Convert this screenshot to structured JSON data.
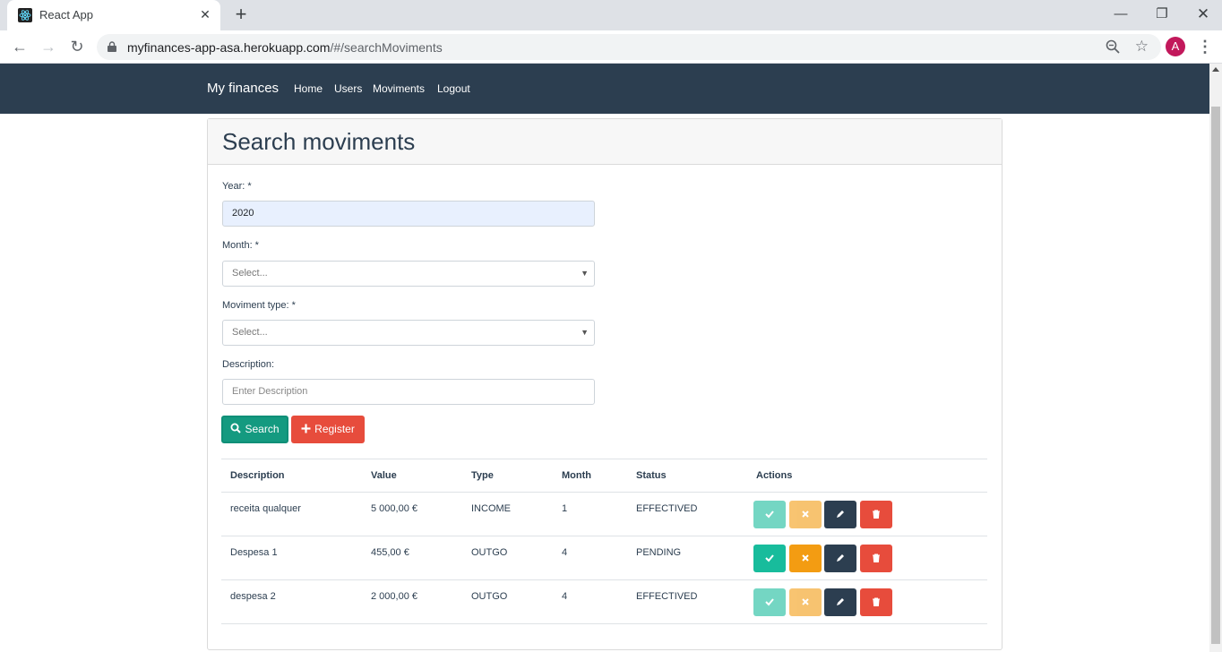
{
  "browser": {
    "tab_title": "React App",
    "url_host": "myfinances-app-asa.herokuapp.com",
    "url_path": "/#/searchMoviments",
    "avatar_letter": "A"
  },
  "navbar": {
    "brand": "My finances",
    "links": [
      "Home",
      "Users",
      "Moviments",
      "Logout"
    ]
  },
  "page": {
    "title": "Search moviments",
    "year_label": "Year: *",
    "year_value": "2020",
    "month_label": "Month: *",
    "month_placeholder": "Select...",
    "type_label": "Moviment type: *",
    "type_placeholder": "Select...",
    "description_label": "Description:",
    "description_placeholder": "Enter Description",
    "search_button": "Search",
    "register_button": "Register"
  },
  "table": {
    "headers": [
      "Description",
      "Value",
      "Type",
      "Month",
      "Status",
      "Actions"
    ],
    "rows": [
      {
        "description": "receita qualquer",
        "value": "5 000,00 €",
        "type": "INCOME",
        "month": "1",
        "status": "EFFECTIVED",
        "actions_enabled": false
      },
      {
        "description": "Despesa 1",
        "value": "455,00 €",
        "type": "OUTGO",
        "month": "4",
        "status": "PENDING",
        "actions_enabled": true
      },
      {
        "description": "despesa 2",
        "value": "2 000,00 €",
        "type": "OUTGO",
        "month": "4",
        "status": "EFFECTIVED",
        "actions_enabled": false
      }
    ]
  },
  "colors": {
    "navbar": "#2c3e50",
    "success": "#18bc9c",
    "warning": "#f39c12",
    "primary": "#2c3e50",
    "danger": "#e74c3c"
  },
  "icons": {
    "search_button": "search-icon",
    "register_button": "plus-icon",
    "row_actions": [
      "check-icon",
      "times-icon",
      "pencil-icon",
      "trash-icon"
    ]
  }
}
